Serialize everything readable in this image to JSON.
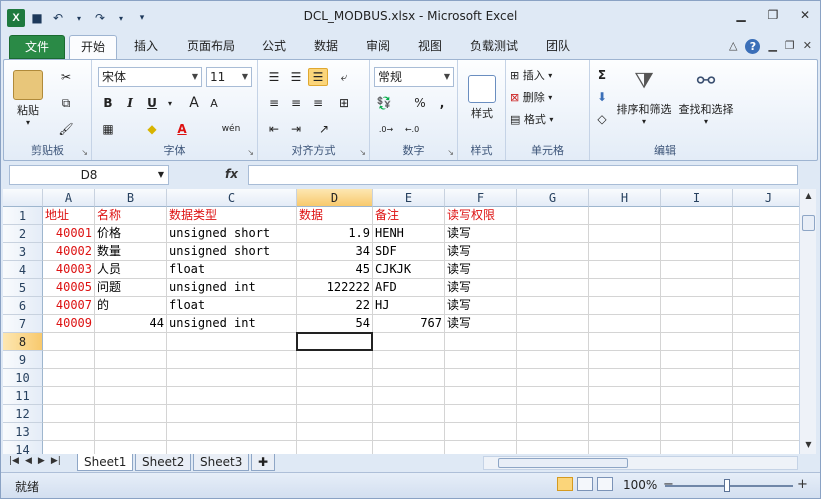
{
  "window": {
    "title": "DCL_MODBUS.xlsx - Microsoft Excel"
  },
  "tabs": [
    "文件",
    "开始",
    "插入",
    "页面布局",
    "公式",
    "数据",
    "审阅",
    "视图",
    "负载测试",
    "团队"
  ],
  "ribbon": {
    "clipboard": {
      "label": "剪贴板",
      "paste": "粘贴"
    },
    "font": {
      "label": "字体",
      "name": "宋体",
      "size": "11",
      "bold": "B",
      "italic": "I",
      "underline": "U",
      "grow": "A",
      "shrink": "A",
      "phonetic": "wén"
    },
    "alignment": {
      "label": "对齐方式"
    },
    "number": {
      "label": "数字",
      "format": "常规",
      "percent": "%",
      "comma": ","
    },
    "styles": {
      "label": "样式"
    },
    "cells": {
      "label": "单元格",
      "insert": "插入",
      "delete": "删除",
      "format": "格式"
    },
    "editing": {
      "label": "编辑",
      "sort_filter": "排序和筛选",
      "find_select": "查找和选择"
    }
  },
  "formula_bar": {
    "name_box": "D8",
    "fx": "fx",
    "value": ""
  },
  "sheet": {
    "columns": [
      "A",
      "B",
      "C",
      "D",
      "E",
      "F",
      "G",
      "H",
      "I",
      "J"
    ],
    "rows": [
      "1",
      "2",
      "3",
      "4",
      "5",
      "6",
      "7",
      "8",
      "9",
      "10",
      "11",
      "12",
      "13",
      "14"
    ],
    "cells": [
      [
        "地址",
        "名称",
        "数据类型",
        "数据",
        "备注",
        "读写权限"
      ],
      [
        "40001",
        "价格",
        "unsigned short",
        "1.9",
        "HENH",
        "读写"
      ],
      [
        "40002",
        "数量",
        "unsigned short",
        "34",
        "SDF",
        "读写"
      ],
      [
        "40003",
        "人员",
        "float",
        "45",
        "CJKJK",
        "读写"
      ],
      [
        "40005",
        "问题",
        "unsigned int",
        "122222",
        "AFD",
        "读写"
      ],
      [
        "40007",
        "的",
        "float",
        "22",
        "HJ",
        "读写"
      ],
      [
        "40009",
        "44",
        "unsigned int",
        "54",
        "767",
        "读写"
      ]
    ],
    "selected": "D8"
  },
  "sheet_tabs": [
    "Sheet1",
    "Sheet2",
    "Sheet3"
  ],
  "status": {
    "ready": "就绪",
    "zoom": "100%"
  }
}
